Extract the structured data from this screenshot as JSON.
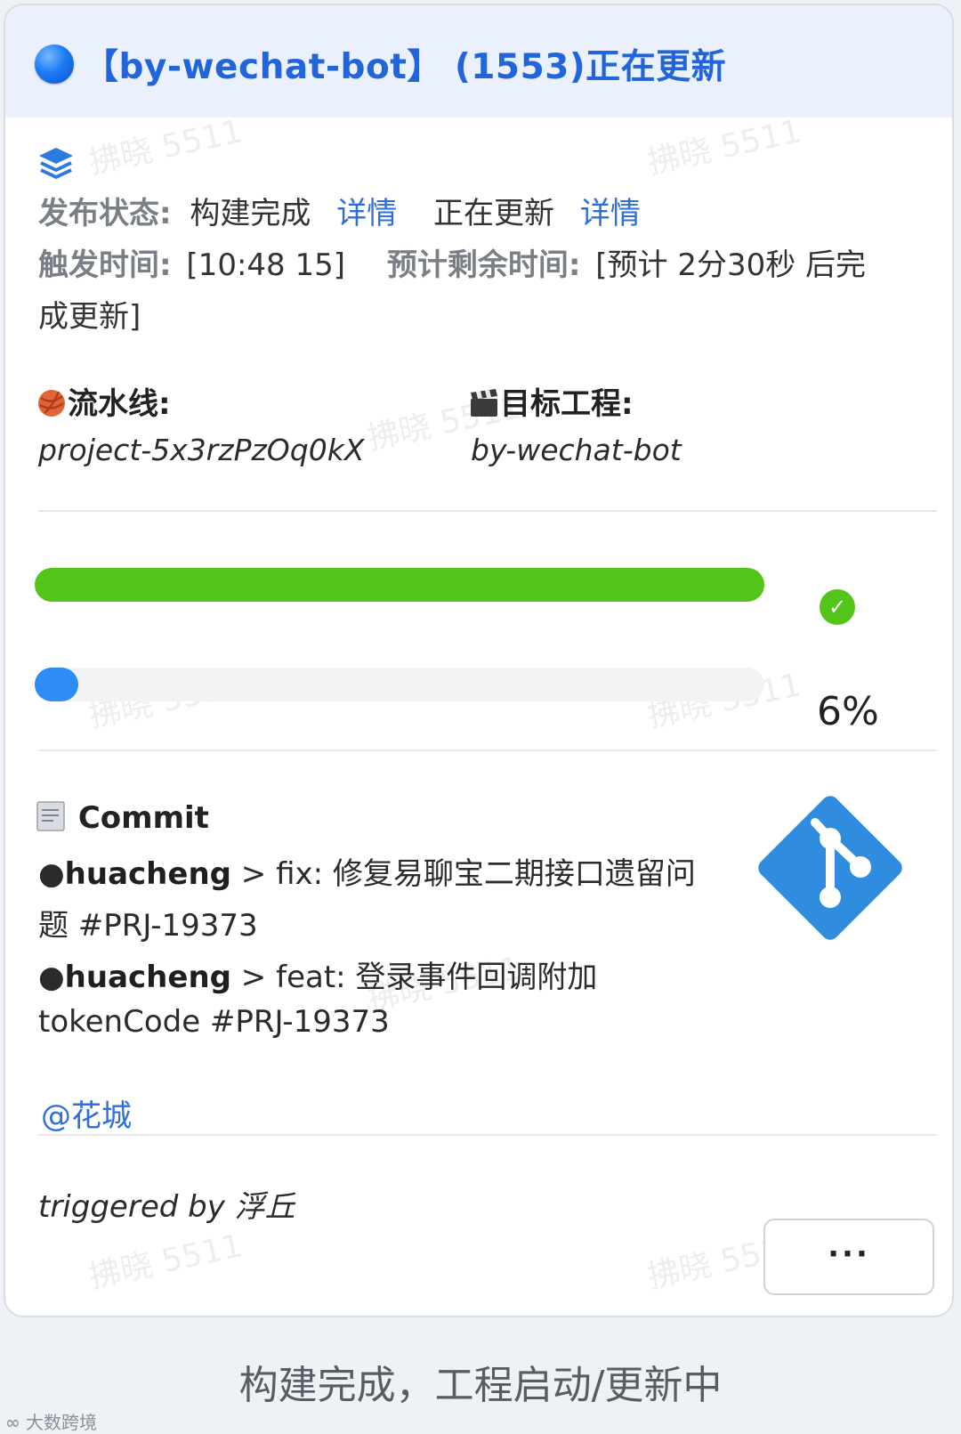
{
  "header": {
    "status_dot_color": "#1c7cf5",
    "title": "【by-wechat-bot】 (1553)正在更新"
  },
  "watermark": "拂晓 5511",
  "status": {
    "icon": "layers-icon",
    "label": "发布状态:",
    "build_state": "构建完成",
    "build_detail_link": "详情",
    "update_state": "正在更新",
    "update_detail_link": "详情",
    "trigger_label": "触发时间:",
    "trigger_time": "[10:48 15]",
    "remaining_label": "预计剩余时间:",
    "remaining_value_line1": "[预计 2分30秒 后完",
    "remaining_value_line2": "成更新]"
  },
  "pipeline": {
    "icon": "yarn-ball-icon",
    "label": "流水线:",
    "value": "project-5x3rzPzOq0kX"
  },
  "target": {
    "icon": "clapperboard-icon",
    "label": "目标工程:",
    "value": "by-wechat-bot"
  },
  "progress": {
    "build": {
      "fraction": 1.0,
      "color": "#52c41a",
      "done_icon": "check-circle-icon"
    },
    "update": {
      "fraction": 0.06,
      "color": "#2f8cf7",
      "percent_label": "6%"
    }
  },
  "commit": {
    "icon": "document-icon",
    "title": "Commit",
    "git_logo": "git-logo-icon",
    "items": [
      {
        "bullet": "●",
        "author": "huacheng",
        "arrow": " > ",
        "message_line1": "fix: 修复易聊宝二期接口遗留问",
        "message_line2": "题 #PRJ-19373"
      },
      {
        "bullet": "●",
        "author": "huacheng",
        "arrow": " > ",
        "message_line1": "feat: 登录事件回调附加",
        "message_line2": "tokenCode #PRJ-19373"
      }
    ],
    "mention": "@花城"
  },
  "footer": {
    "triggered_by": "triggered by 浮丘",
    "more_button": "···"
  },
  "caption": "构建完成，工程启动/更新中",
  "corner_logo": "大数跨境"
}
